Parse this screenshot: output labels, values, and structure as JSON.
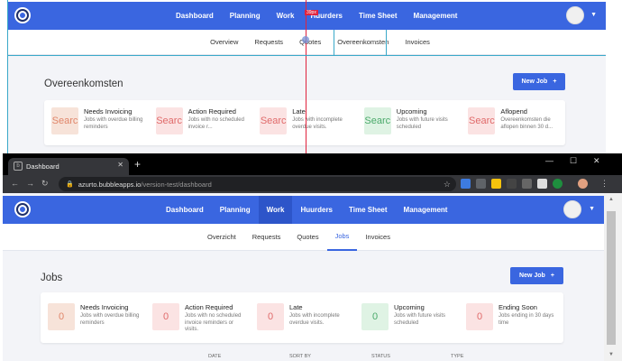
{
  "editor_bg": {
    "nav": [
      "Dashboard",
      "Planning",
      "Work",
      "Huurders",
      "Time Sheet",
      "Management"
    ],
    "dim_tag": "39px",
    "subnav": [
      "Overview",
      "Requests",
      "Quotes",
      "Overeenkomsten",
      "Invoices"
    ],
    "title": "Overeenkomsten",
    "new_job": "New Job",
    "plus": "+",
    "cards": [
      {
        "badge": "Searc",
        "title": "Needs Invoicing",
        "desc": "Jobs with overdue billing reminders",
        "color": "#f7e3d9",
        "fg": "#e0866a"
      },
      {
        "badge": "Searc",
        "title": "Action Required",
        "desc": "Jobs with no scheduled invoice r...",
        "color": "#fbe3e3",
        "fg": "#e06a6a"
      },
      {
        "badge": "Searc",
        "title": "Late",
        "desc": "Jobs with incomplete overdue visits.",
        "color": "#fbe3e3",
        "fg": "#e06a6a"
      },
      {
        "badge": "Searc",
        "title": "Upcoming",
        "desc": "Jobs with future visits scheduled",
        "color": "#dff3e4",
        "fg": "#4aa96a"
      },
      {
        "badge": "Searc",
        "title": "Aflopend",
        "desc": "Overeenkomsten die aflopen binnen 30 d...",
        "color": "#fbe3e3",
        "fg": "#e06a6a"
      }
    ]
  },
  "browser": {
    "tab_title": "Dashboard",
    "tab_icon": "b",
    "close": "✕",
    "new_tab": "+",
    "win_min": "—",
    "win_max": "☐",
    "win_close": "✕",
    "back": "←",
    "fwd": "→",
    "reload": "↻",
    "url_host": "azurto.bubbleapps.io",
    "url_path": "/version-test/dashboard",
    "lock": "🔒",
    "star": "☆",
    "ext_colors": [
      "#3d7be0",
      "#5f6368",
      "#f4c20d",
      "#444",
      "#666",
      "#fff",
      "#1e8e3e",
      "#888",
      "#e0a080"
    ]
  },
  "app": {
    "nav": [
      "Dashboard",
      "Planning",
      "Work",
      "Huurders",
      "Time Sheet",
      "Management"
    ],
    "active_nav": "Work",
    "subnav": [
      "Overzicht",
      "Requests",
      "Quotes",
      "Jobs",
      "Invoices"
    ],
    "active_subnav": "Jobs",
    "title": "Jobs",
    "new_job": "New Job",
    "plus": "+",
    "caret": "▼",
    "cards": [
      {
        "count": "0",
        "title": "Needs Invoicing",
        "desc": "Jobs with overdue billing reminders",
        "color": "#f7e3d9",
        "fg": "#e0866a"
      },
      {
        "count": "0",
        "title": "Action Required",
        "desc": "Jobs with no scheduled invoice reminders or visits.",
        "color": "#fbe3e3",
        "fg": "#e06a6a"
      },
      {
        "count": "0",
        "title": "Late",
        "desc": "Jobs with incomplete overdue visits.",
        "color": "#fbe3e3",
        "fg": "#e06a6a"
      },
      {
        "count": "0",
        "title": "Upcoming",
        "desc": "Jobs with future visits scheduled",
        "color": "#dff3e4",
        "fg": "#4aa96a"
      },
      {
        "count": "0",
        "title": "Ending Soon",
        "desc": "Jobs ending in 30 days time",
        "color": "#fbe3e3",
        "fg": "#e06a6a"
      }
    ],
    "table_cols": [
      "DATE",
      "SORT BY",
      "STATUS",
      "TYPE"
    ]
  },
  "colors": {
    "accent": "#3a66e0",
    "guide": "#e0233d"
  }
}
